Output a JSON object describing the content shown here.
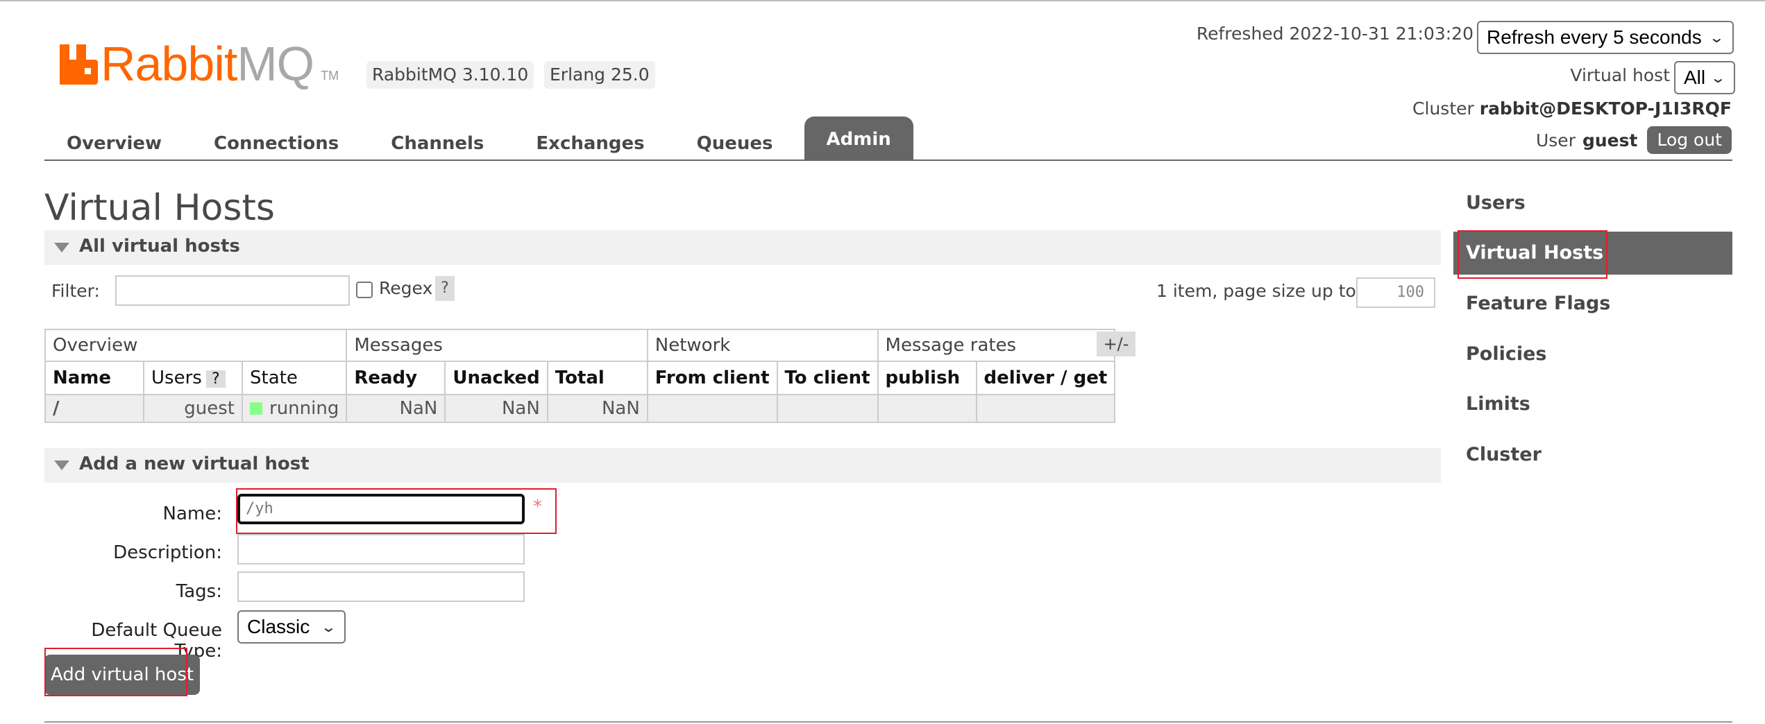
{
  "brand": {
    "rabbit": "Rabbit",
    "mq": "MQ",
    "tm": "TM"
  },
  "versions": {
    "rabbitmq": "RabbitMQ 3.10.10",
    "erlang": "Erlang 25.0"
  },
  "header": {
    "refreshed": "Refreshed 2022-10-31 21:03:20",
    "refresh_select": "Refresh every 5 seconds",
    "vhost_label": "Virtual host",
    "vhost_select": "All",
    "cluster_label": "Cluster",
    "cluster_name": "rabbit@DESKTOP-J1I3RQF",
    "user_label": "User",
    "user_name": "guest",
    "logout": "Log out"
  },
  "tabs": [
    "Overview",
    "Connections",
    "Channels",
    "Exchanges",
    "Queues",
    "Admin"
  ],
  "active_tab": "Admin",
  "sidebar": [
    "Users",
    "Virtual Hosts",
    "Feature Flags",
    "Policies",
    "Limits",
    "Cluster"
  ],
  "active_sidebar": "Virtual Hosts",
  "page_title": "Virtual Hosts",
  "all_section": {
    "title": "All virtual hosts",
    "filter_label": "Filter:",
    "filter_value": "",
    "regex_label": "Regex",
    "help": "?",
    "pager_text": "1 item, page size up to",
    "page_size": "100",
    "plus_minus": "+/-"
  },
  "table": {
    "groups": [
      "Overview",
      "Messages",
      "Network",
      "Message rates"
    ],
    "headers": [
      "Name",
      "Users",
      "State",
      "Ready",
      "Unacked",
      "Total",
      "From client",
      "To client",
      "publish",
      "deliver / get"
    ],
    "rows": [
      {
        "name": "/",
        "users": "guest",
        "state": "running",
        "ready": "NaN",
        "unacked": "NaN",
        "total": "NaN",
        "from_client": "",
        "to_client": "",
        "publish": "",
        "deliver_get": ""
      }
    ]
  },
  "add_section": {
    "title": "Add a new virtual host",
    "name_label": "Name:",
    "name_value": "/yh",
    "required_mark": "*",
    "description_label": "Description:",
    "description_value": "",
    "tags_label": "Tags:",
    "tags_value": "",
    "queue_type_label": "Default Queue Type:",
    "queue_type_value": "Classic",
    "submit": "Add virtual host"
  },
  "colors": {
    "brand_orange": "#ff6600",
    "nav_active": "#666666",
    "highlight": "#e01d2b",
    "running": "#88ff88"
  }
}
